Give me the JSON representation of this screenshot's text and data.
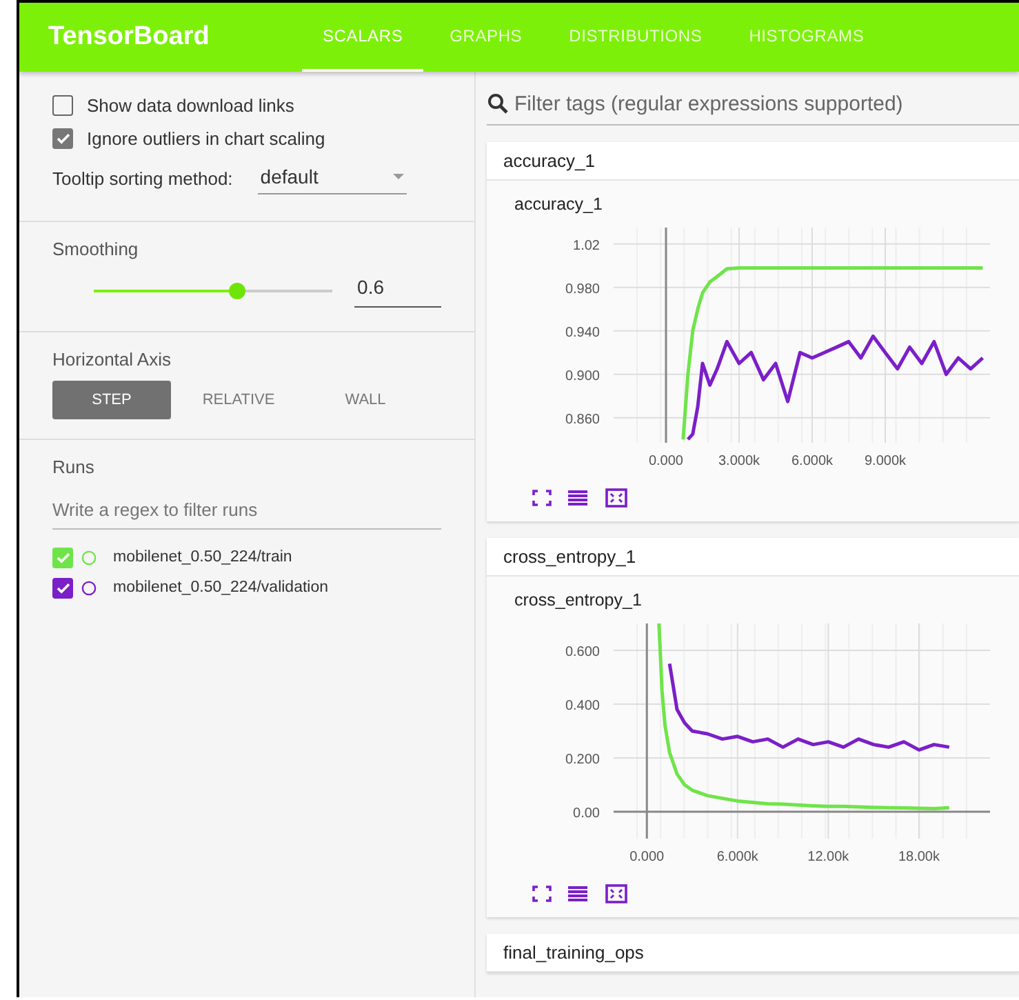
{
  "app": {
    "title": "TensorBoard"
  },
  "tabs": [
    {
      "label": "SCALARS",
      "selected": true
    },
    {
      "label": "GRAPHS",
      "selected": false
    },
    {
      "label": "DISTRIBUTIONS",
      "selected": false
    },
    {
      "label": "HISTOGRAMS",
      "selected": false
    }
  ],
  "sidebar": {
    "options": [
      {
        "label": "Show data download links",
        "checked": false
      },
      {
        "label": "Ignore outliers in chart scaling",
        "checked": true
      }
    ],
    "tooltip_sorting": {
      "label": "Tooltip sorting method:",
      "value": "default"
    },
    "smoothing": {
      "label": "Smoothing",
      "level": 0.6,
      "value": "0.6"
    },
    "horizontal_axis": {
      "label": "Horizontal Axis",
      "options": [
        {
          "label": "STEP",
          "selected": true
        },
        {
          "label": "RELATIVE",
          "selected": false
        },
        {
          "label": "WALL",
          "selected": false
        }
      ]
    },
    "runs": {
      "label": "Runs",
      "placeholder": "Write a regex to filter runs",
      "items": [
        {
          "name": "mobilenet_0.50_224/train",
          "checked": true,
          "color": "#6fe44a"
        },
        {
          "name": "mobilenet_0.50_224/validation",
          "checked": true,
          "color": "#7b1fc9"
        }
      ]
    }
  },
  "main": {
    "search": {
      "placeholder": "Filter tags (regular expressions supported)"
    },
    "sections": [
      {
        "title": "accuracy_1",
        "chart": {
          "title": "accuracy_1",
          "chart_data": {
            "type": "line",
            "x": [
              700,
              900,
              1100,
              1300,
              1500,
              1800,
              2100,
              2500,
              3000,
              3500,
              4000,
              4500,
              5000,
              5500,
              6000,
              6500,
              7000,
              7500,
              8000,
              8500,
              9000,
              9500,
              10000,
              10500,
              11000,
              11500,
              12000,
              12500,
              13000
            ],
            "grid": true,
            "series": [
              {
                "color": "#6fe44a",
                "values": [
                  0.84,
                  0.9,
                  0.94,
                  0.96,
                  0.975,
                  0.985,
                  0.99,
                  0.997,
                  0.998,
                  0.998,
                  0.998,
                  0.998,
                  0.998,
                  0.998,
                  0.998,
                  0.998,
                  0.998,
                  0.998,
                  0.998,
                  0.998,
                  0.998,
                  0.998,
                  0.998,
                  0.998,
                  0.998,
                  0.998,
                  0.998,
                  0.998,
                  0.998
                ]
              },
              {
                "color": "#7b1fc9",
                "values": [
                  null,
                  0.84,
                  0.845,
                  0.87,
                  0.91,
                  0.89,
                  0.905,
                  0.93,
                  0.91,
                  0.92,
                  0.895,
                  0.91,
                  0.875,
                  0.92,
                  0.915,
                  0.92,
                  0.925,
                  0.93,
                  0.915,
                  0.935,
                  0.92,
                  0.905,
                  0.925,
                  0.91,
                  0.93,
                  0.9,
                  0.915,
                  0.905,
                  0.915
                ]
              }
            ],
            "xlim": [
              -2150,
              13300
            ],
            "ylim": [
              0.837,
              1.035
            ],
            "xticks": [
              {
                "value": 0,
                "label": "0.000"
              },
              {
                "value": 3000,
                "label": "3.000k"
              },
              {
                "value": 6000,
                "label": "6.000k"
              },
              {
                "value": 9000,
                "label": "9.000k"
              }
            ],
            "yticks": [
              {
                "value": 0.86,
                "label": "0.860"
              },
              {
                "value": 0.9,
                "label": "0.900"
              },
              {
                "value": 0.94,
                "label": "0.940"
              },
              {
                "value": 0.98,
                "label": "0.980"
              },
              {
                "value": 1.02,
                "label": "1.02"
              }
            ]
          }
        }
      },
      {
        "title": "cross_entropy_1",
        "chart": {
          "title": "cross_entropy_1",
          "chart_data": {
            "type": "line",
            "x": [
              800,
              1000,
              1200,
              1500,
              2000,
              2500,
              3000,
              4000,
              5000,
              6000,
              7000,
              8000,
              9000,
              10000,
              11000,
              12000,
              13000,
              14000,
              15000,
              16000,
              17000,
              18000,
              19000,
              20000
            ],
            "grid": true,
            "series": [
              {
                "color": "#6fe44a",
                "values": [
                  0.7,
                  0.45,
                  0.32,
                  0.22,
                  0.14,
                  0.1,
                  0.08,
                  0.06,
                  0.05,
                  0.04,
                  0.035,
                  0.03,
                  0.028,
                  0.025,
                  0.022,
                  0.02,
                  0.02,
                  0.018,
                  0.016,
                  0.015,
                  0.014,
                  0.013,
                  0.012,
                  0.015
                ]
              },
              {
                "color": "#7b1fc9",
                "values": [
                  null,
                  null,
                  null,
                  0.55,
                  0.38,
                  0.33,
                  0.3,
                  0.29,
                  0.27,
                  0.28,
                  0.26,
                  0.27,
                  0.24,
                  0.27,
                  0.25,
                  0.26,
                  0.24,
                  0.27,
                  0.25,
                  0.24,
                  0.26,
                  0.23,
                  0.25,
                  0.24
                ]
              }
            ],
            "xlim": [
              -2200,
              22700
            ],
            "ylim": [
              -0.1,
              0.7
            ],
            "xticks": [
              {
                "value": 0,
                "label": "0.000"
              },
              {
                "value": 6000,
                "label": "6.000k"
              },
              {
                "value": 12000,
                "label": "12.00k"
              },
              {
                "value": 18000,
                "label": "18.00k"
              }
            ],
            "yticks": [
              {
                "value": 0,
                "label": "0.00"
              },
              {
                "value": 0.2,
                "label": "0.200"
              },
              {
                "value": 0.4,
                "label": "0.400"
              },
              {
                "value": 0.6,
                "label": "0.600"
              }
            ]
          }
        }
      },
      {
        "title": "final_training_ops"
      }
    ]
  }
}
